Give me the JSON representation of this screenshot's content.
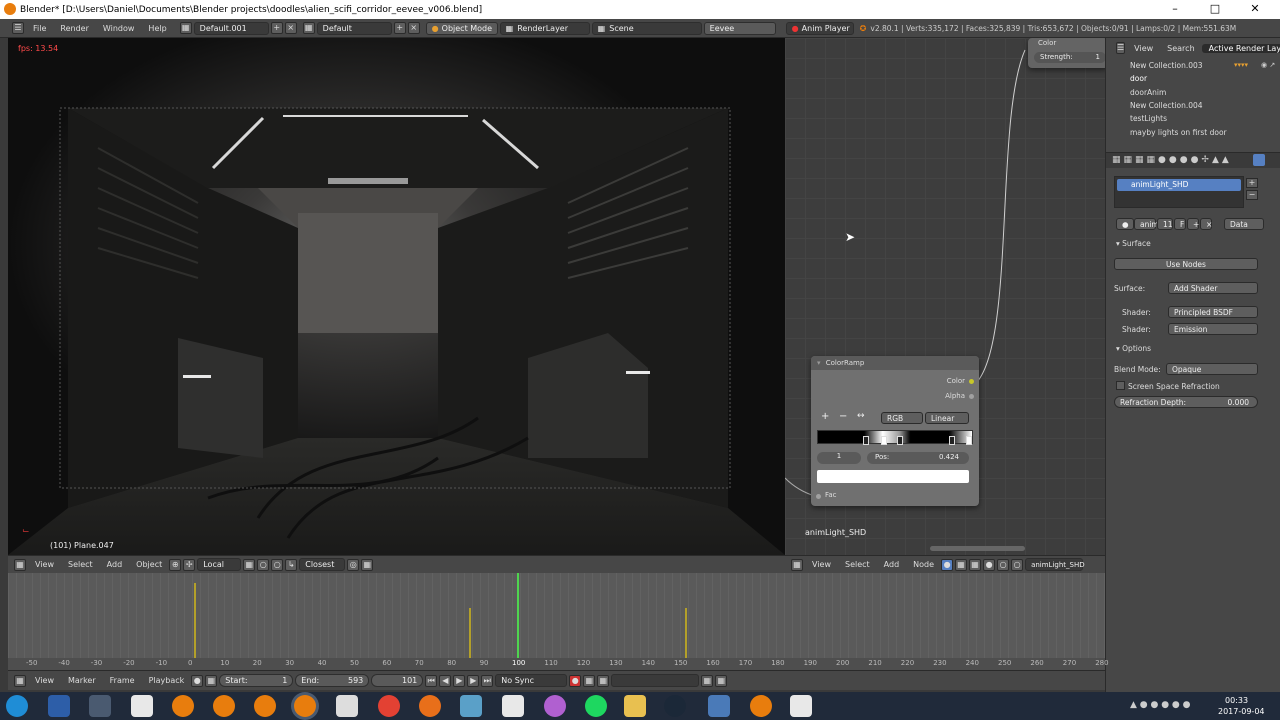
{
  "window": {
    "title": "Blender* [D:\\Users\\Daniel\\Documents\\Blender projects\\doodles\\alien_scifi_corridor_eevee_v006.blend]"
  },
  "menu": [
    "File",
    "Render",
    "Window",
    "Help"
  ],
  "header": {
    "screen": "Default.001",
    "layout": "Default",
    "mode": "Object Mode",
    "render_layer": "RenderLayer",
    "scene": "Scene",
    "engine": "Eevee",
    "anim_player": "Anim Player",
    "stats": "v2.80.1 | Verts:335,172 | Faces:325,839 | Tris:653,672 | Objects:0/91 | Lamps:0/2 | Mem:551.63M"
  },
  "viewport": {
    "fps": "fps: 13.54",
    "object_info": "(101) Plane.047",
    "header_items": [
      "View",
      "Select",
      "Add",
      "Object"
    ],
    "orientation": "Local",
    "snap": "Closest"
  },
  "node_editor": {
    "colorramp_title": "ColorRamp",
    "out_color": "Color",
    "out_alpha": "Alpha",
    "color_mode": "RGB",
    "interpolation": "Linear",
    "stop_index": "1",
    "pos_label": "Pos:",
    "pos_value": "0.424",
    "fac_label": "Fac",
    "top_node_color": "Color",
    "strength_label": "Strength:",
    "strength_value": "1",
    "material_name": "animLight_SHD",
    "header_items": [
      "View",
      "Select",
      "Add",
      "Node"
    ],
    "header_material": "animLight_SHD"
  },
  "outliner": {
    "tabs": [
      "View",
      "Search",
      "Active Render Layer"
    ],
    "items": [
      "New Collection.003",
      "door",
      "doorAnim",
      "New Collection.004",
      "testLights",
      "mayby lights on first door"
    ]
  },
  "properties": {
    "material_slot": "animLight_SHD",
    "datablock": "anim",
    "users": "11",
    "fake": "F",
    "link": "Data",
    "surface_panel": "Surface",
    "use_nodes": "Use Nodes",
    "surface_label": "Surface:",
    "surface_value": "Add Shader",
    "shader1_label": "Shader:",
    "shader1_value": "Principled BSDF",
    "shader2_label": "Shader:",
    "shader2_value": "Emission",
    "options_panel": "Options",
    "blend_mode_label": "Blend Mode:",
    "blend_mode_value": "Opaque",
    "ssr_label": "Screen Space Refraction",
    "refraction_label": "Refraction Depth:",
    "refraction_value": "0.000"
  },
  "timeline": {
    "ruler": [
      "-50",
      "-40",
      "-30",
      "-20",
      "-10",
      "0",
      "10",
      "20",
      "30",
      "40",
      "50",
      "60",
      "70",
      "80",
      "90",
      "100",
      "110",
      "120",
      "130",
      "140",
      "150",
      "160",
      "170",
      "180",
      "190",
      "200",
      "210",
      "220",
      "230",
      "240",
      "250",
      "260",
      "270",
      "280"
    ],
    "header_items": [
      "View",
      "Marker",
      "Frame",
      "Playback"
    ],
    "start_label": "Start:",
    "start_value": "1",
    "end_label": "End:",
    "end_value": "593",
    "current_frame": "101",
    "sync": "No Sync"
  },
  "taskbar": {
    "time": "00:33",
    "date": "2017-09-04"
  }
}
